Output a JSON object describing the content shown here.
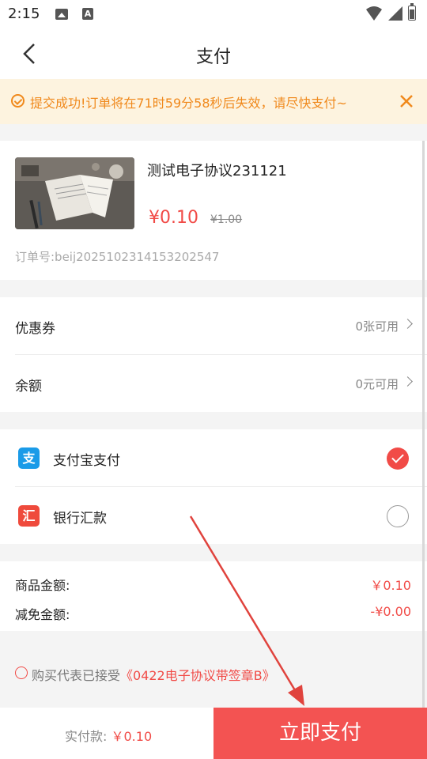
{
  "status_bar": {
    "time": "2:15",
    "a_icon_letter": "A"
  },
  "nav": {
    "title": "支付",
    "back_icon": "chevron-left-icon"
  },
  "notice": {
    "text": "提交成功!订单将在71时59分58秒后失效，请尽快支付~",
    "color": "#f0891c",
    "background": "#fdf3df"
  },
  "product": {
    "name": "测试电子协议231121",
    "price": "¥0.10",
    "original_price": "¥1.00",
    "order_no": "订单号:beij2025102314153202547"
  },
  "discounts": {
    "coupon": {
      "label": "优惠券",
      "value": "0张可用"
    },
    "balance": {
      "label": "余额",
      "value": "0元可用"
    }
  },
  "payment": {
    "alipay": {
      "label": "支付宝支付",
      "icon_char": "支",
      "selected": true
    },
    "bank": {
      "label": "银行汇款",
      "icon_char": "汇",
      "selected": false
    }
  },
  "amounts": {
    "goods_label": "商品金额:",
    "goods_value": "￥0.10",
    "discount_label": "减免金额:",
    "discount_value": "-¥0.00"
  },
  "agreement": {
    "prefix": "购买代表已接受",
    "link": "《0422电子协议带签章B》"
  },
  "footer": {
    "total_label": "实付款:",
    "total_value": "￥0.10",
    "pay_button": "立即支付"
  },
  "colors": {
    "accent": "#f14b47",
    "alipay_blue": "#1a9be8"
  }
}
